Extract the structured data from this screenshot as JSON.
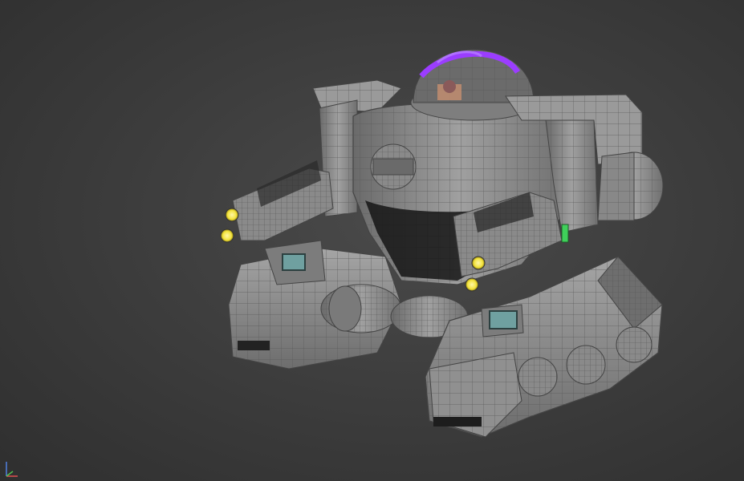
{
  "viewport": {
    "kind": "3d-perspective-viewport",
    "background_color": "#3b3b3b",
    "render_mode": "shaded-with-wireframe"
  },
  "model": {
    "subject": "tracked-mech-robot",
    "shade_color": "#8c8c8c",
    "wire_color": "#5a5a5a",
    "accent_color": "#9b3dff",
    "glow_color": "#f2e23a",
    "screen_color": "#6fa0a0",
    "indicator_color": "#3fd05a"
  },
  "gizmo": {
    "icon": "axis-tripod-icon",
    "x_color": "#e05050",
    "y_color": "#50c050",
    "z_color": "#5080e0"
  }
}
